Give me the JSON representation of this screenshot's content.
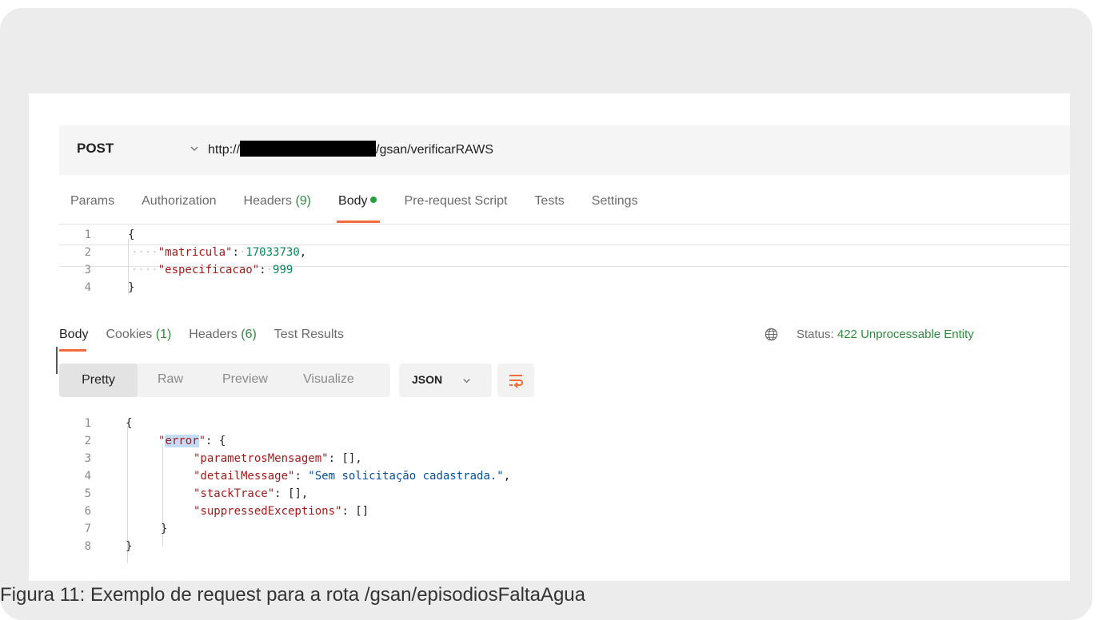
{
  "request": {
    "method": "POST",
    "url_prefix": "http://",
    "url_suffix": "/gsan/verificarRAWS"
  },
  "request_tabs": [
    {
      "label": "Params"
    },
    {
      "label": "Authorization"
    },
    {
      "label": "Headers",
      "count": "(9)"
    },
    {
      "label": "Body",
      "active": true
    },
    {
      "label": "Pre-request Script"
    },
    {
      "label": "Tests"
    },
    {
      "label": "Settings"
    }
  ],
  "request_body": {
    "line_numbers": [
      "1",
      "2",
      "3",
      "4"
    ],
    "open": "{",
    "key1": "\"matricula\"",
    "val1": "17033730",
    "key2": "\"especificacao\"",
    "val2": "999",
    "close": "}"
  },
  "response_tabs": [
    {
      "label": "Body",
      "active": true
    },
    {
      "label": "Cookies",
      "count": "(1)"
    },
    {
      "label": "Headers",
      "count": "(6)"
    },
    {
      "label": "Test Results"
    }
  ],
  "status": {
    "label": "Status:",
    "value": "422 Unprocessable Entity"
  },
  "view_modes": [
    "Pretty",
    "Raw",
    "Preview",
    "Visualize"
  ],
  "format": "JSON",
  "response_body": {
    "line_numbers": [
      "1",
      "2",
      "3",
      "4",
      "5",
      "6",
      "7",
      "8"
    ],
    "open": "{",
    "error_key": "error",
    "k1": "\"parametrosMensagem\"",
    "k2": "\"detailMessage\"",
    "v2": "\"Sem solicitação cadastrada.\"",
    "k3": "\"stackTrace\"",
    "k4": "\"suppressedExceptions\"",
    "close_inner": "}",
    "close": "}"
  },
  "caption": "Figura 11: Exemplo de request para a rota /gsan/episodiosFaltaAgua",
  "colors": {
    "accent": "#f26b3a",
    "status_ok": "#2e8b3e",
    "json_key": "#a21b1b",
    "json_number": "#098658",
    "json_string": "#0451a5"
  }
}
